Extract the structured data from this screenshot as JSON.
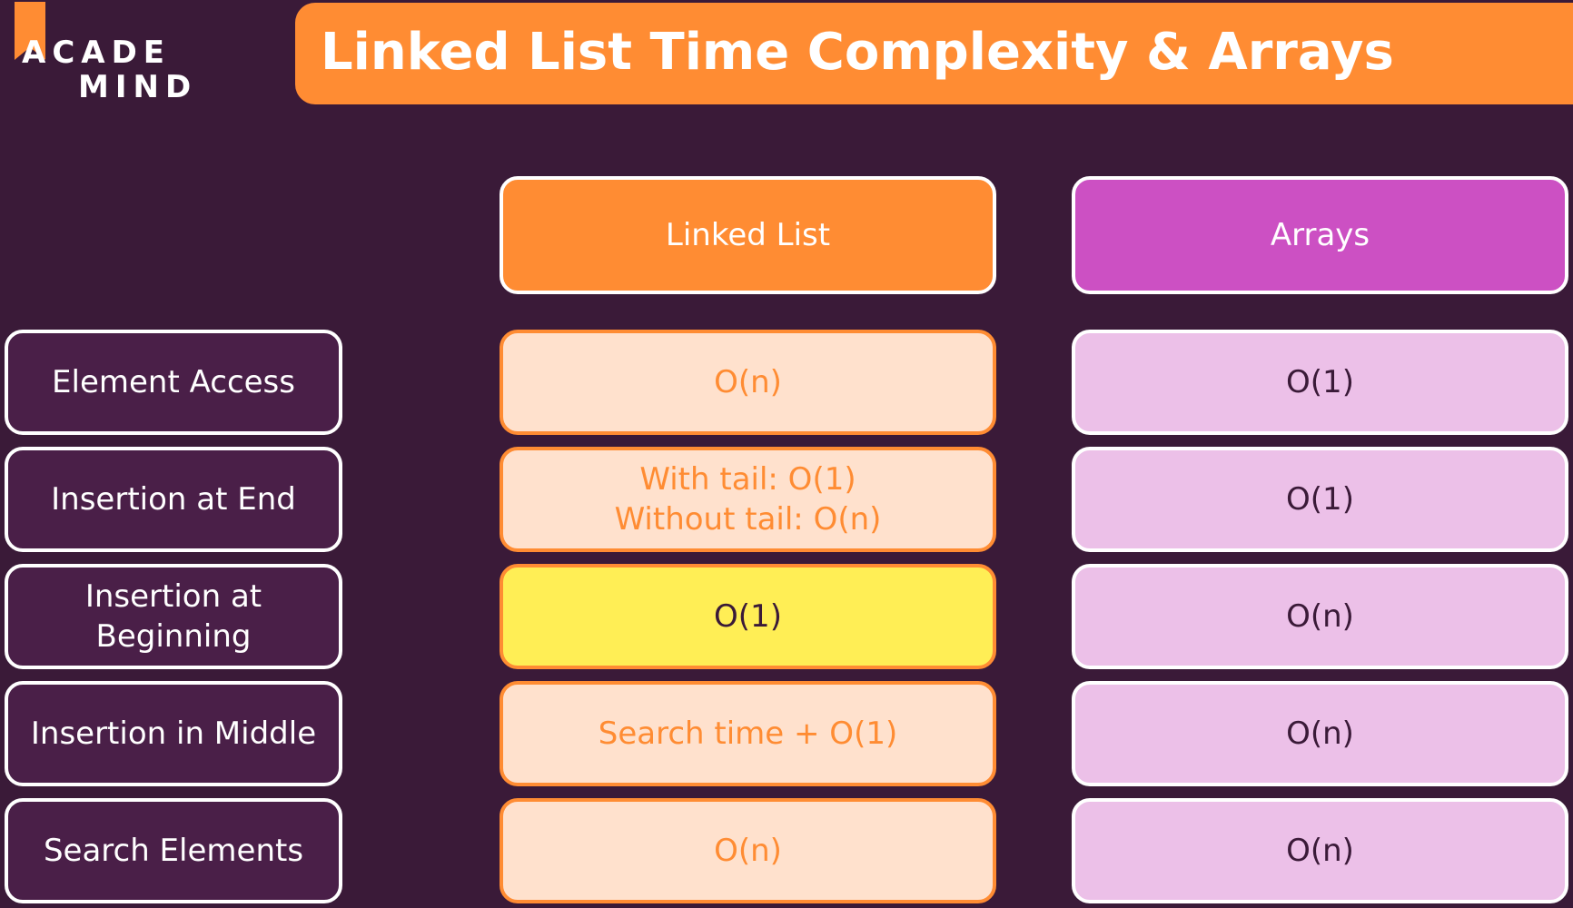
{
  "logo": {
    "line1": "ACADE",
    "line2": "MIND"
  },
  "title": "Linked List Time Complexity & Arrays",
  "headers": {
    "linked_list": "Linked List",
    "arrays": "Arrays"
  },
  "rows": [
    {
      "label": "Element Access",
      "linked_list": "O(n)",
      "arrays": "O(1)"
    },
    {
      "label": "Insertion at End",
      "linked_list": [
        "With tail: O(1)",
        "Without tail: O(n)"
      ],
      "arrays": "O(1)"
    },
    {
      "label": [
        "Insertion at",
        "Beginning"
      ],
      "linked_list": "O(1)",
      "arrays": "O(n)"
    },
    {
      "label": "Insertion in Middle",
      "linked_list": "Search time + O(1)",
      "arrays": "O(n)"
    },
    {
      "label": "Search Elements",
      "linked_list": "O(n)",
      "arrays": "O(n)"
    }
  ],
  "colors": {
    "background": "#3a1a38",
    "accent_orange": "#ff8c33",
    "accent_magenta": "#cc50c3",
    "linked_list_cell": "#ffe1cd",
    "array_cell": "#ecc0e8",
    "highlight": "#ffee55",
    "label_cell": "#4a1f48"
  }
}
